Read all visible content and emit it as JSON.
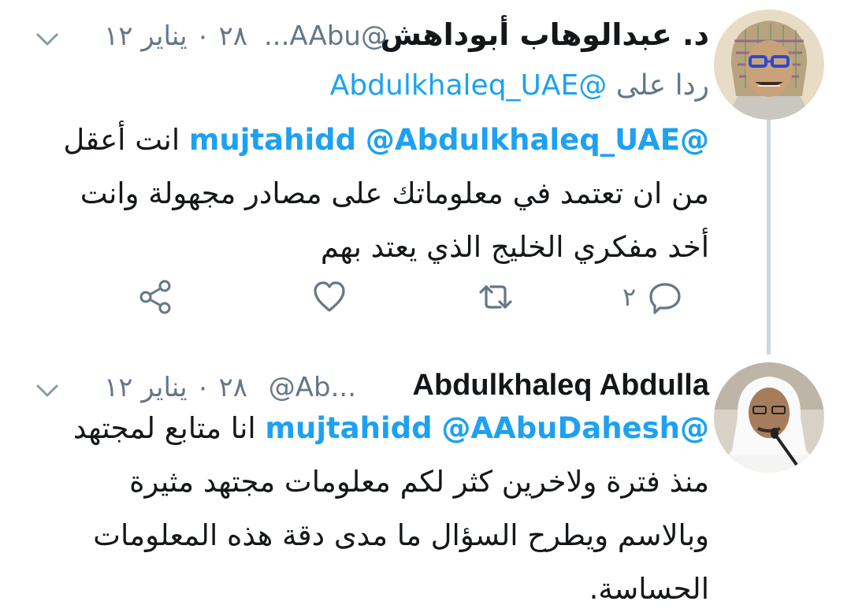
{
  "tweets": [
    {
      "name": "د. عبدالوهاب أبوداهش",
      "handle": "@AAbu...",
      "time": "٢٨ ٠ يناير ١٢",
      "reply_prefix": "ردا على",
      "reply_handle": "@Abdulkhaleq_UAE",
      "mentions": [
        "@Abdulkhaleq_UAE",
        "@mujtahidd"
      ],
      "text_line1": "انت أعقل",
      "text_line2": "من ان تعتمد في معلوماتك على مصادر مجهولة وانت",
      "text_line3": "أخد مفكري الخليج الذي يعتد بهم",
      "reply_count": "٢",
      "avatar_icon": "cartoon-avatar"
    },
    {
      "name": "Abdulkhaleq Abdulla",
      "handle": "@Ab...",
      "time": "٢٨ ٠ يناير ١٢",
      "mentions": [
        "@AAbuDahesh",
        "@mujtahidd"
      ],
      "text_line1": "انا متابع لمجتهد",
      "text_line2": "منذ فترة ولاخرين كثر لكم معلومات مجتهد مثيرة",
      "text_line3": "وبالاسم ويطرح السؤال ما مدى دقة هذه المعلومات",
      "text_line4": "الحساسة.",
      "avatar_icon": "photo-avatar"
    }
  ],
  "colors": {
    "link": "#1da1f2",
    "muted": "#657786",
    "text": "#14171a",
    "thread_line": "#ccd6dd"
  }
}
